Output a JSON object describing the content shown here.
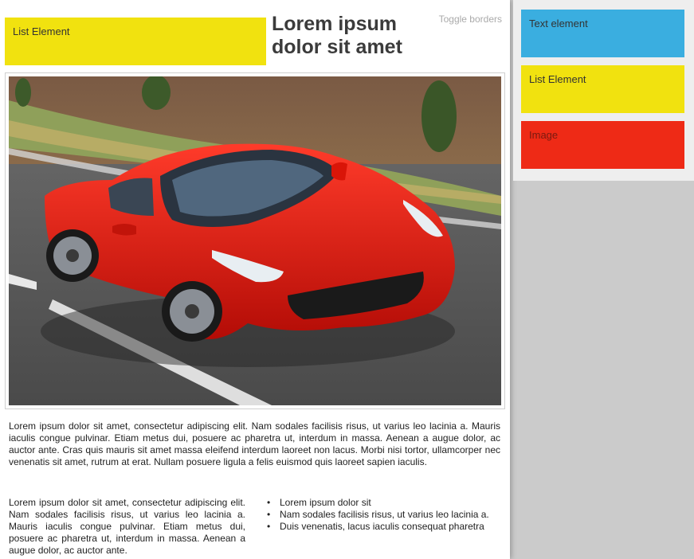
{
  "canvas": {
    "list_block_label": "List Element",
    "headline": "Lorem ipsum dolor sit amet",
    "toggle_label": "Toggle borders",
    "paragraph": "Lorem ipsum dolor sit amet, consectetur adipiscing elit. Nam sodales facilisis risus, ut varius leo lacinia a. Mauris iaculis congue pulvinar. Etiam metus dui, posuere ac pharetra ut, interdum in massa. Aenean a augue dolor, ac auctor ante. Cras quis mauris sit amet massa eleifend interdum laoreet non lacus. Morbi nisi tortor, ullamcorper nec venenatis sit amet, rutrum at erat. Nullam posuere ligula a felis euismod quis laoreet sapien iaculis.",
    "left_column": "Lorem ipsum dolor sit amet, consectetur adipiscing elit. Nam sodales facilisis risus, ut varius leo lacinia a. Mauris iaculis congue pulvinar. Etiam metus dui, posuere ac pharetra ut, interdum in massa. Aenean a augue dolor, ac auctor ante.",
    "bullets": [
      "Lorem ipsum dolor sit",
      "Nam sodales facilisis risus, ut varius leo lacinia a.",
      "Duis venenatis, lacus iaculis consequat pharetra"
    ]
  },
  "palette": {
    "tiles": [
      {
        "label": "Text element",
        "color": "#3aaee0"
      },
      {
        "label": "List Element",
        "color": "#f1e20f"
      },
      {
        "label": "Image",
        "color": "#ee2a16"
      }
    ]
  }
}
